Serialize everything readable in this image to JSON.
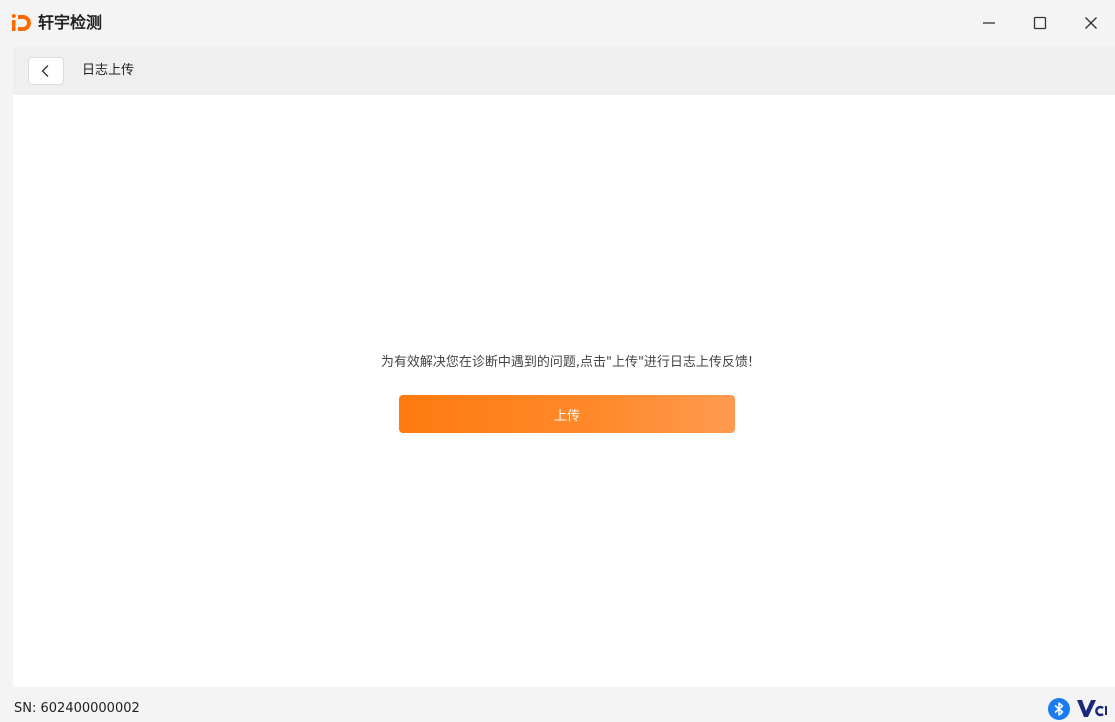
{
  "window": {
    "app_title": "轩宇检测",
    "minimize_icon": "minimize-icon",
    "maximize_icon": "maximize-icon",
    "close_icon": "close-icon"
  },
  "nav": {
    "back_icon": "chevron-left-icon",
    "title": "日志上传"
  },
  "main": {
    "hint": "为有效解决您在诊断中遇到的问题,点击\"上传\"进行日志上传反馈!",
    "upload_label": "上传"
  },
  "status": {
    "sn_label": "SN:",
    "sn_value": "602400000002",
    "bluetooth_icon": "bluetooth-icon",
    "vci_logo_text": "VCI"
  },
  "colors": {
    "accent": "#ff7a0f",
    "accent_light": "#ff9a50",
    "bluetooth": "#1a7cf0",
    "vci_logo": "#1a2a7a"
  }
}
